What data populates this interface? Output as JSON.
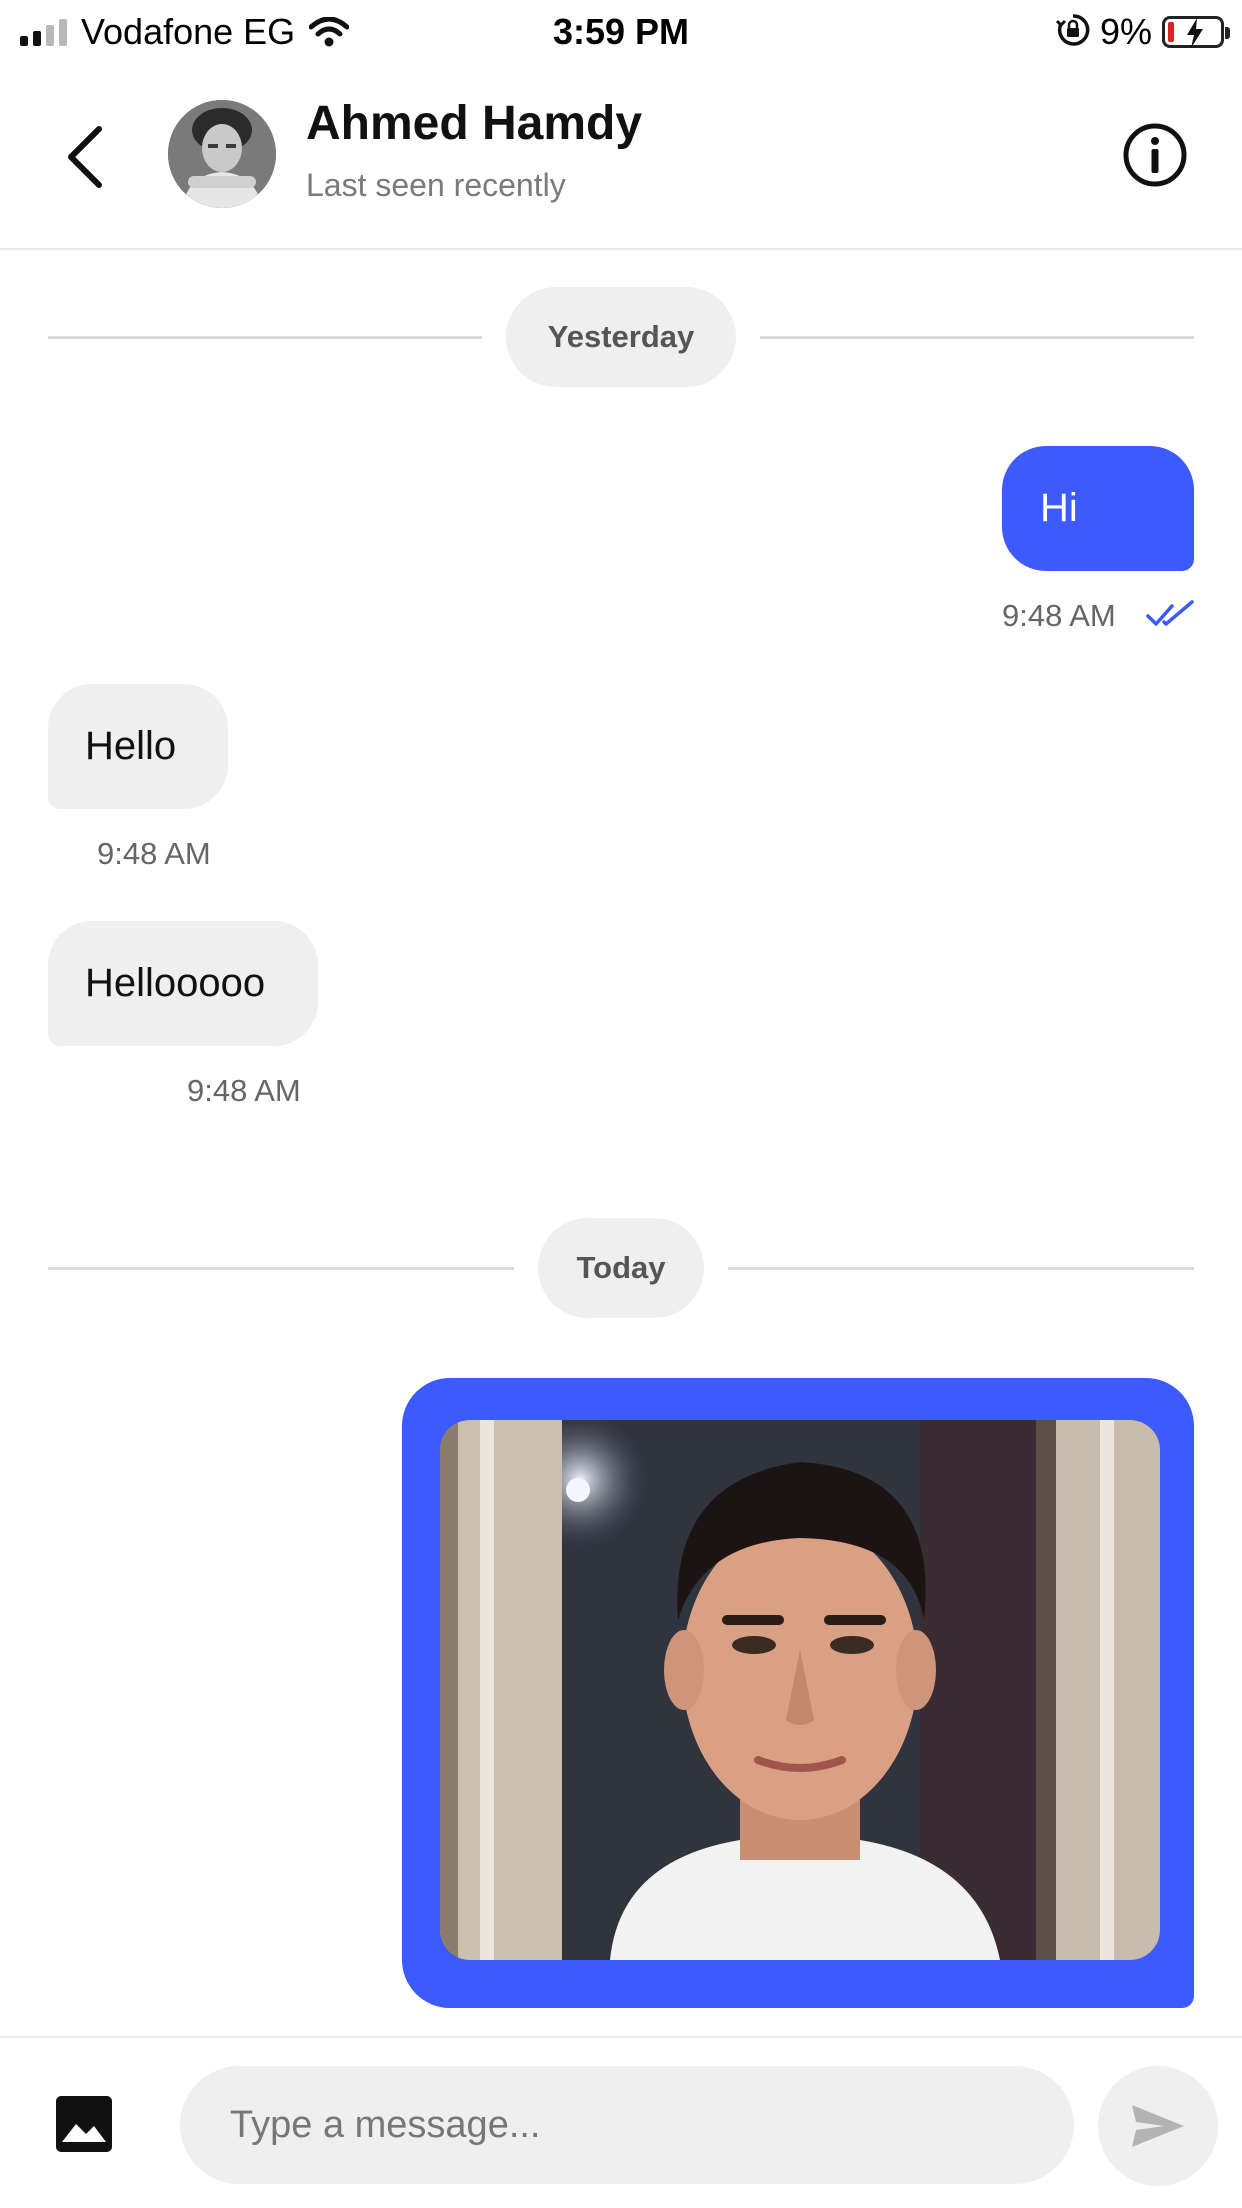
{
  "status_bar": {
    "carrier": "Vodafone EG",
    "time": "3:59 PM",
    "battery_percent": "9%",
    "battery_level": 0.09,
    "icons": [
      "signal-icon",
      "wifi-icon",
      "orientation-lock-icon",
      "battery-charging-icon"
    ]
  },
  "header": {
    "contact_name": "Ahmed Hamdy",
    "contact_status": "Last seen recently",
    "icons": [
      "back-arrow-icon",
      "info-icon"
    ]
  },
  "messages": {
    "separator_yesterday": "Yesterday",
    "separator_today": "Today",
    "items": [
      {
        "direction": "outgoing",
        "text": "Hi",
        "time": "9:48 AM",
        "read": true
      },
      {
        "direction": "incoming",
        "text": "Hello",
        "time": "9:48 AM"
      },
      {
        "direction": "incoming",
        "text": "Hellooooo",
        "time": "9:48 AM"
      },
      {
        "direction": "outgoing",
        "type": "image",
        "description": "selfie photo"
      }
    ]
  },
  "composer": {
    "placeholder": "Type a message...",
    "icons": [
      "gallery-icon",
      "send-icon"
    ]
  },
  "colors": {
    "accent": "#3d5afe",
    "incoming_bubble": "#efefef",
    "pill": "#efefef",
    "battery_low": "#e02020"
  }
}
